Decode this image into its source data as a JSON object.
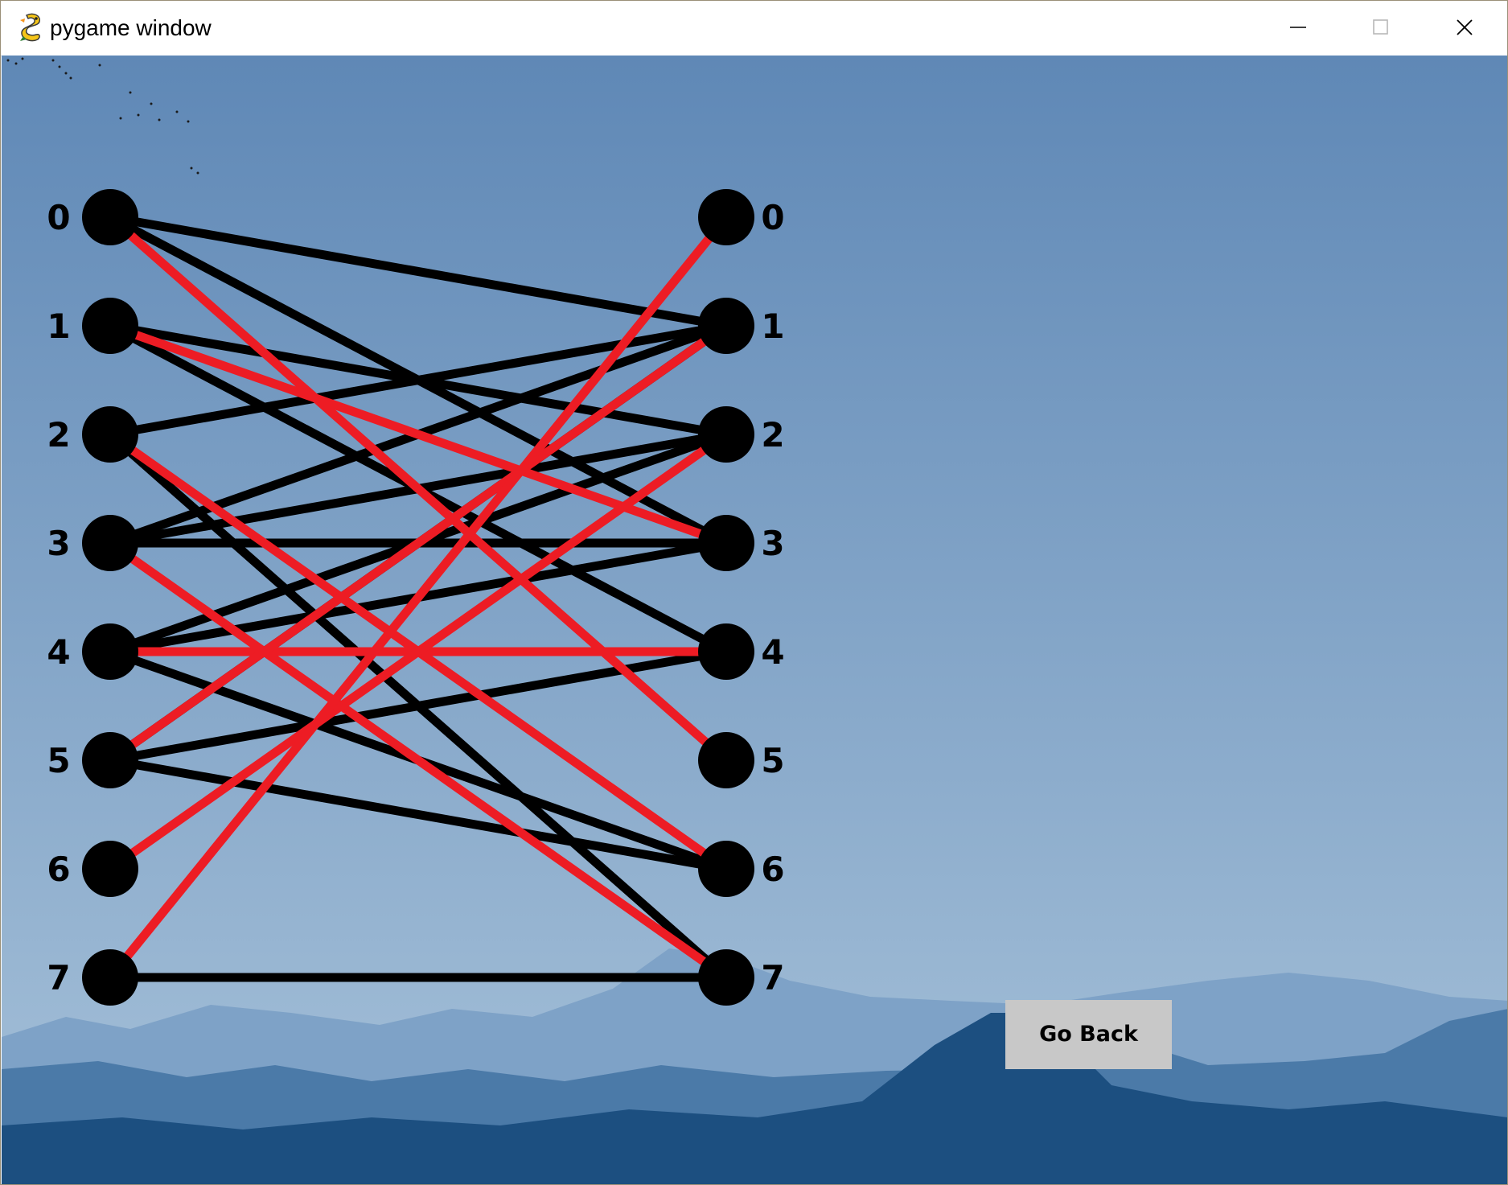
{
  "window": {
    "title": "pygame window",
    "app_icon": "pygame-snake-icon",
    "controls": {
      "minimize": "minimize-icon",
      "maximize": "maximize-icon",
      "close": "close-icon"
    }
  },
  "graph": {
    "left_labels": [
      "0",
      "1",
      "2",
      "3",
      "4",
      "5",
      "6",
      "7"
    ],
    "right_labels": [
      "0",
      "1",
      "2",
      "3",
      "4",
      "5",
      "6",
      "7"
    ],
    "edges": [
      {
        "from": 0,
        "to": 1,
        "color": "#000000"
      },
      {
        "from": 0,
        "to": 3,
        "color": "#000000"
      },
      {
        "from": 1,
        "to": 2,
        "color": "#000000"
      },
      {
        "from": 1,
        "to": 4,
        "color": "#000000"
      },
      {
        "from": 2,
        "to": 1,
        "color": "#000000"
      },
      {
        "from": 2,
        "to": 7,
        "color": "#000000"
      },
      {
        "from": 3,
        "to": 1,
        "color": "#000000"
      },
      {
        "from": 3,
        "to": 2,
        "color": "#000000"
      },
      {
        "from": 3,
        "to": 3,
        "color": "#000000"
      },
      {
        "from": 4,
        "to": 2,
        "color": "#000000"
      },
      {
        "from": 4,
        "to": 3,
        "color": "#000000"
      },
      {
        "from": 4,
        "to": 6,
        "color": "#000000"
      },
      {
        "from": 5,
        "to": 4,
        "color": "#000000"
      },
      {
        "from": 5,
        "to": 6,
        "color": "#000000"
      },
      {
        "from": 5,
        "to": 1,
        "color": "#000000"
      },
      {
        "from": 7,
        "to": 7,
        "color": "#000000"
      },
      {
        "from": 0,
        "to": 5,
        "color": "#ed1c24"
      },
      {
        "from": 1,
        "to": 3,
        "color": "#ed1c24"
      },
      {
        "from": 2,
        "to": 6,
        "color": "#ed1c24"
      },
      {
        "from": 3,
        "to": 7,
        "color": "#ed1c24"
      },
      {
        "from": 4,
        "to": 4,
        "color": "#ed1c24"
      },
      {
        "from": 5,
        "to": 1,
        "color": "#ed1c24"
      },
      {
        "from": 6,
        "to": 2,
        "color": "#ed1c24"
      },
      {
        "from": 7,
        "to": 0,
        "color": "#ed1c24"
      }
    ]
  },
  "buttons": {
    "go_back": "Go Back"
  },
  "colors": {
    "matching_edge": "#ed1c24",
    "graph_edge": "#000000",
    "node": "#000000",
    "button_bg": "#c8c8c8",
    "sky_top": "#5f88b6",
    "sky_bottom": "#a6c1d9",
    "mountain_far": "#7ea2c7",
    "mountain_mid": "#4b7aa8",
    "mountain_near": "#1c4f80"
  }
}
